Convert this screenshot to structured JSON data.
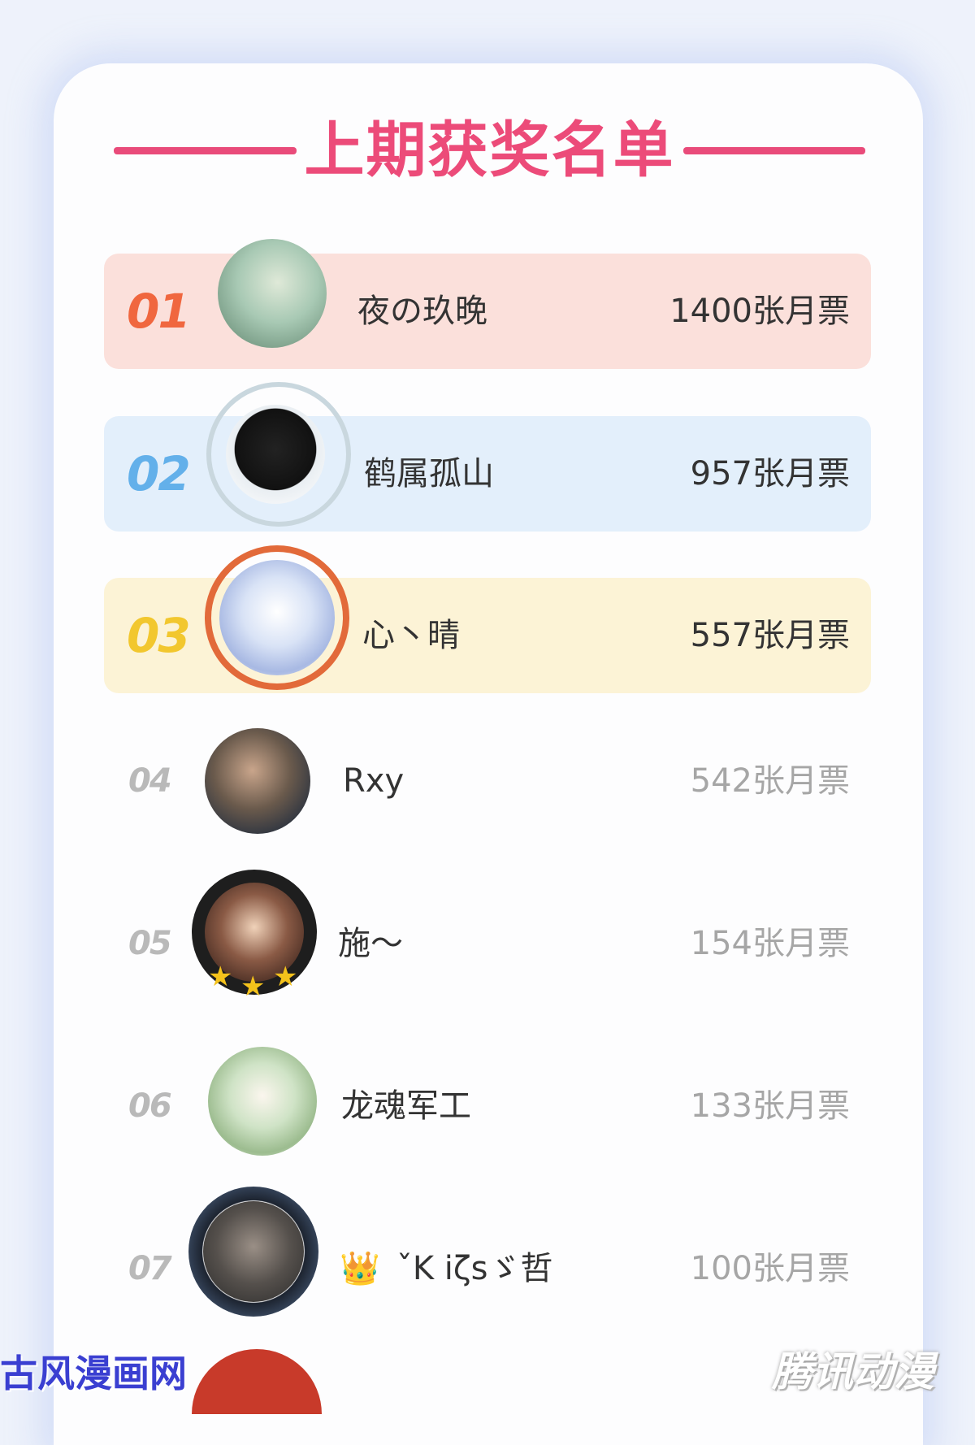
{
  "title": "上期获奖名单",
  "ranking": [
    {
      "rank": "01",
      "name": "夜の玖晚",
      "votes": "1400张月票"
    },
    {
      "rank": "02",
      "name": "鹤属孤山",
      "votes": "957张月票"
    },
    {
      "rank": "03",
      "name": "心丶晴",
      "votes": "557张月票"
    },
    {
      "rank": "04",
      "name": "Rxy",
      "votes": "542张月票"
    },
    {
      "rank": "05",
      "name": "施～",
      "votes": "154张月票"
    },
    {
      "rank": "06",
      "name": "龙魂军工",
      "votes": "133张月票"
    },
    {
      "rank": "07",
      "name": "ˇK iζsゞ哲",
      "votes": "100张月票"
    }
  ],
  "watermarks": {
    "left": "古风漫画网",
    "right": "腾讯动漫"
  },
  "colors": {
    "title": "#ec4b79",
    "rank1_bg": "#fbe0db",
    "rank2_bg": "#e3effb",
    "rank3_bg": "#fcf3d6"
  }
}
